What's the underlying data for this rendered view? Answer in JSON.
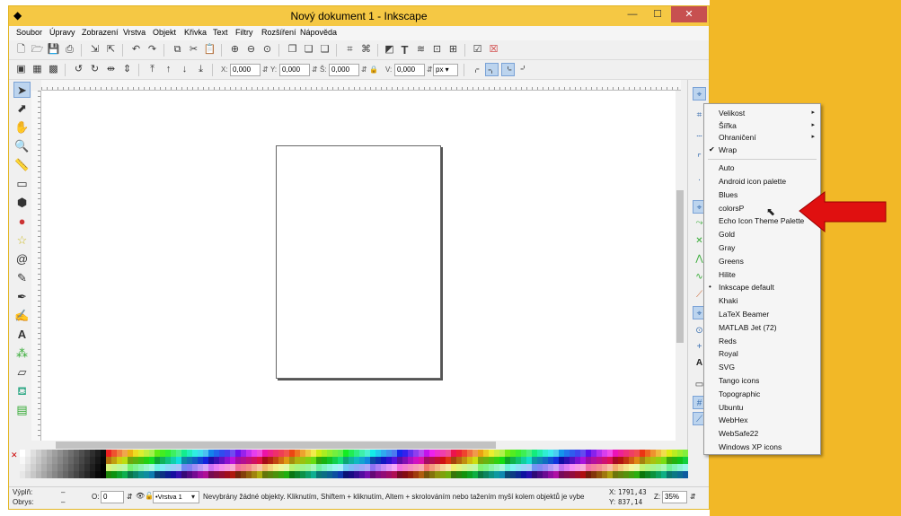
{
  "window": {
    "title": "Nový dokument 1 - Inkscape",
    "minimize": "—",
    "maximize": "☐",
    "close": "✕"
  },
  "menu": [
    "Soubor",
    "Úpravy",
    "Zobrazení",
    "Vrstva",
    "Objekt",
    "Křivka",
    "Text",
    "Filtry",
    "Rozšíření",
    "Nápověda"
  ],
  "toolbar2": {
    "x_label": "X:",
    "x_value": "0,000",
    "y_label": "Y:",
    "y_value": "0,000",
    "w_label": "Š:",
    "w_value": "0,000",
    "h_label": "V:",
    "h_value": "0,000",
    "unit": "px"
  },
  "statusbar": {
    "fill_label": "Výplň:",
    "fill_value": "–",
    "stroke_label": "Obrys:",
    "stroke_value": "–",
    "opacity_label": "O:",
    "opacity_value": "0",
    "layer": "•Vrstva 1",
    "message": "Nevybrány žádné objekty. Kliknutím, Shiftem + kliknutím, Altem + skrolováním nebo tažením myší kolem objektů je vybe",
    "coord_x_label": "X:",
    "coord_x": "1791,43",
    "coord_y_label": "Y:",
    "coord_y": "837,14",
    "zoom_label": "Z:",
    "zoom": "35%"
  },
  "context_menu": {
    "submenus": [
      {
        "label": "Velikost",
        "arrow": "▸"
      },
      {
        "label": "Šířka",
        "arrow": "▸"
      },
      {
        "label": "Ohraničení",
        "arrow": "▸"
      }
    ],
    "wrap": {
      "label": "Wrap",
      "mark": "✔"
    },
    "palettes": [
      "Auto",
      "Android icon palette",
      "Blues",
      "colorsP",
      "Echo Icon Theme Palette",
      "Gold",
      "Gray",
      "Greens",
      "Hilite",
      "Inkscape default",
      "Khaki",
      "LaTeX Beamer",
      "MATLAB Jet (72)",
      "Reds",
      "Royal",
      "SVG",
      "Tango icons",
      "Topographic",
      "Ubuntu",
      "WebHex",
      "WebSafe22",
      "Windows XP icons"
    ],
    "selected_palette": "Inkscape default",
    "selected_mark": "•"
  },
  "colors": {
    "title_bar": "#f5c844",
    "close_button": "#c75050",
    "background_right": "#f2b827",
    "arrow": "#e01010"
  },
  "icons": {
    "cursor": "mouse-pointer",
    "arrow_annotation": "red-arrow-left"
  }
}
